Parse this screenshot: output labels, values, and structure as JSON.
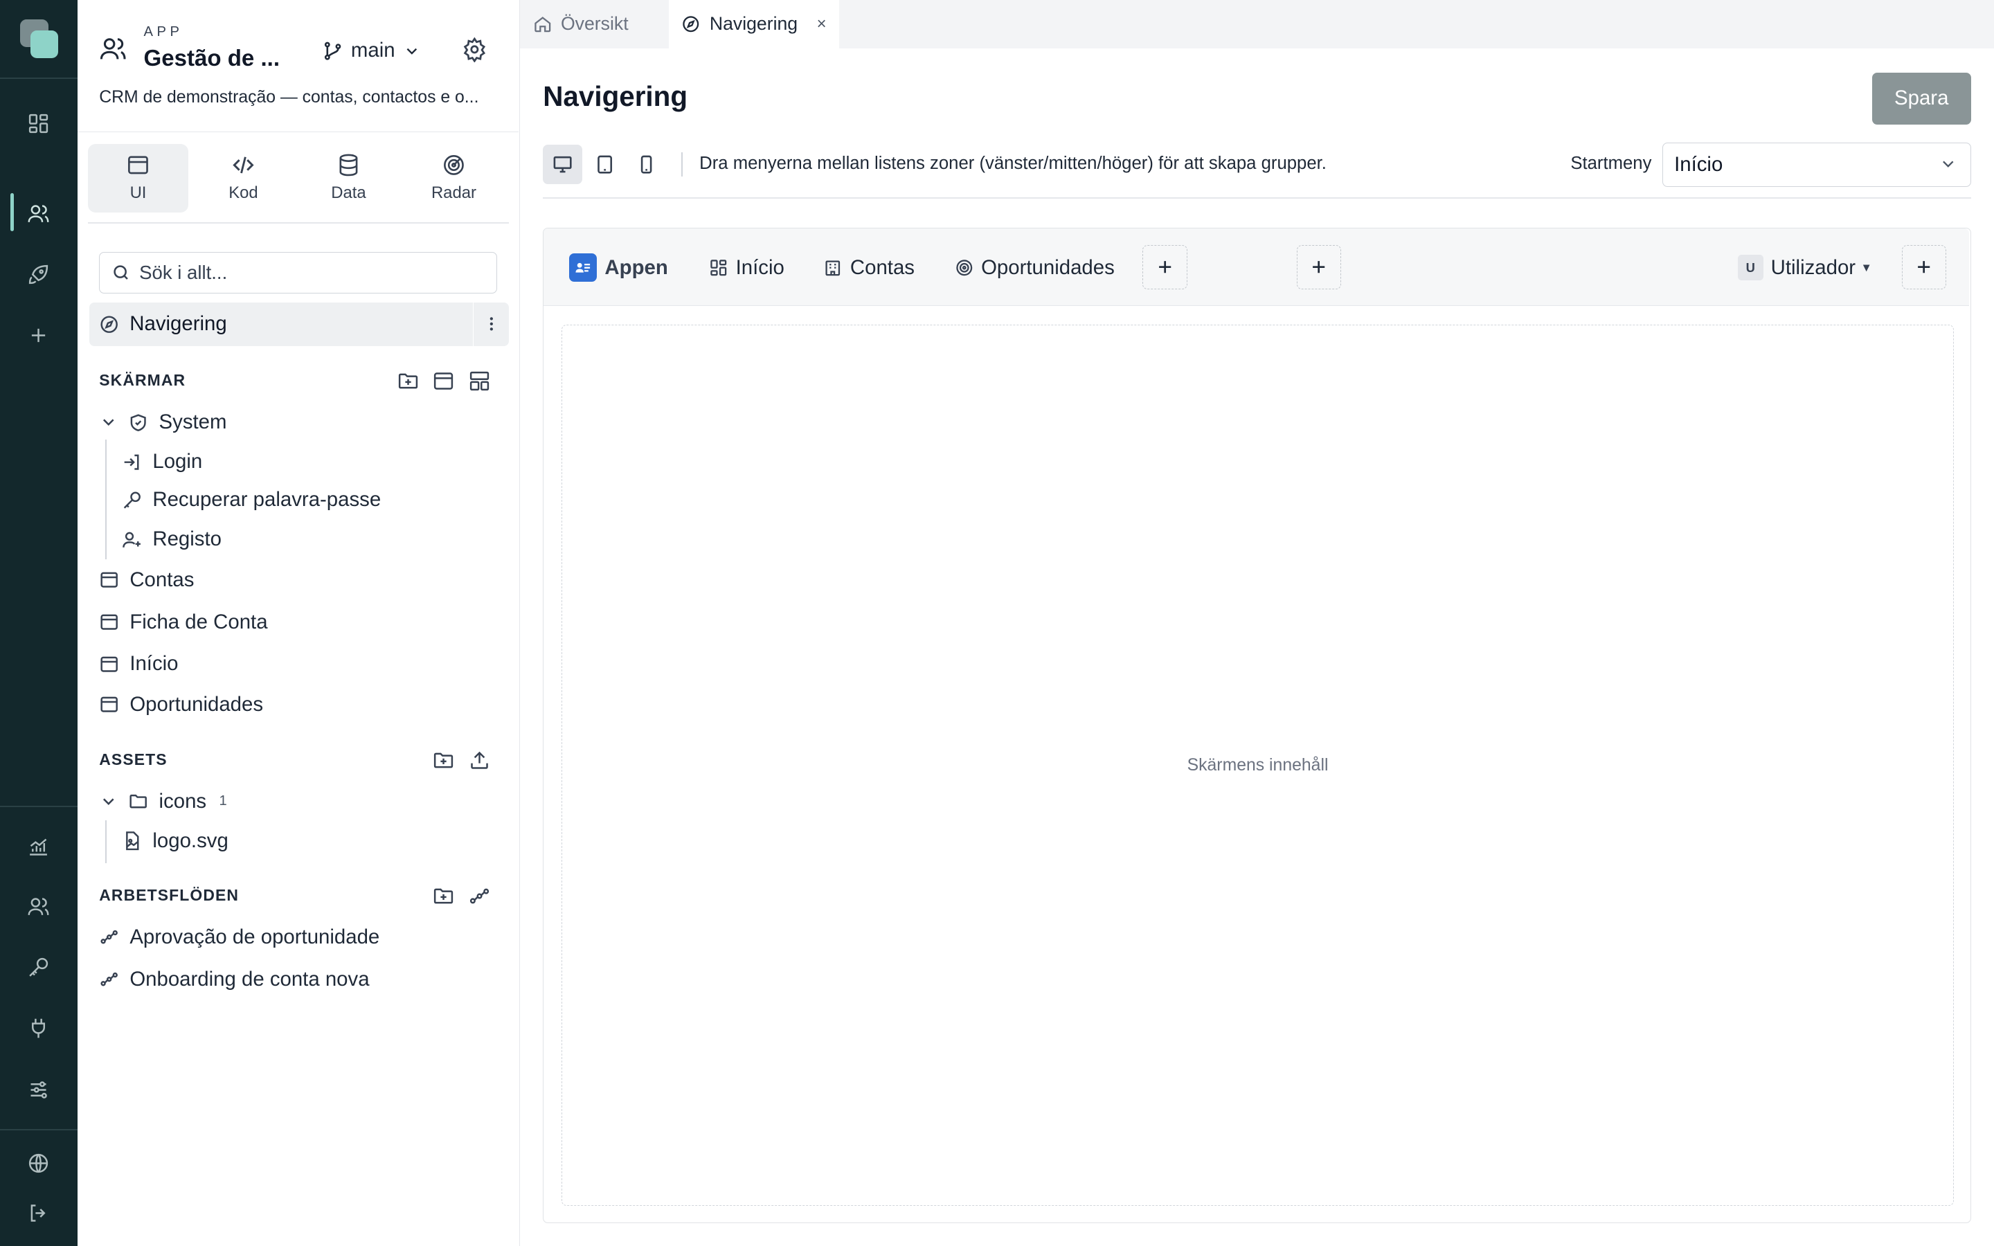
{
  "app": {
    "kicker": "APP",
    "title": "Gestão de ...",
    "description": "CRM de demonstração — contas, contactos e o...",
    "branch": "main"
  },
  "modes": [
    {
      "label": "UI",
      "icon": "window-icon",
      "active": true
    },
    {
      "label": "Kod",
      "icon": "code-icon",
      "active": false
    },
    {
      "label": "Data",
      "icon": "database-icon",
      "active": false
    },
    {
      "label": "Radar",
      "icon": "radar-icon",
      "active": false
    }
  ],
  "search": {
    "placeholder": "Sök i allt..."
  },
  "navigation_item": {
    "label": "Navigering"
  },
  "screens": {
    "heading": "SKÄRMAR",
    "system_folder": "System",
    "system_children": [
      "Login",
      "Recuperar palavra-passe",
      "Registo"
    ],
    "items": [
      "Contas",
      "Ficha de Conta",
      "Início",
      "Oportunidades"
    ]
  },
  "assets": {
    "heading": "ASSETS",
    "folder": "icons",
    "folder_count": "1",
    "file": "logo.svg"
  },
  "workflows": {
    "heading": "ARBETSFLÖDEN",
    "items": [
      "Aprovação de oportunidade",
      "Onboarding de conta nova"
    ]
  },
  "tabs": [
    {
      "label": "Översikt",
      "icon": "home-icon",
      "active": false
    },
    {
      "label": "Navigering",
      "icon": "compass-icon",
      "active": true,
      "close": "×"
    }
  ],
  "page": {
    "title": "Navigering",
    "save_label": "Spara",
    "hint": "Dra menyerna mellan listens zoner (vänster/mitten/höger) för att skapa grupper.",
    "start_menu_label": "Startmeny",
    "start_menu_value": "Início"
  },
  "preview": {
    "brand": "Appen",
    "menu_items": [
      "Início",
      "Contas",
      "Oportunidades"
    ],
    "user_initial": "U",
    "user_label": "Utilizador",
    "content_placeholder": "Skärmens innehåll"
  },
  "colors": {
    "rail_bg": "#13282c",
    "accent": "#8ed3c8",
    "brand_blue": "#2f6fd6",
    "save_button": "#8a9597"
  }
}
